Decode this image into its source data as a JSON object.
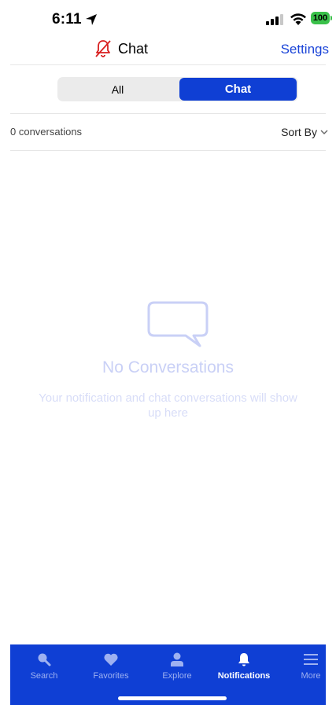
{
  "status_bar": {
    "time": "6:11",
    "battery": "100"
  },
  "header": {
    "title": "Chat",
    "settings_label": "Settings"
  },
  "segments": {
    "all_label": "All",
    "chat_label": "Chat",
    "selected": "Chat"
  },
  "list": {
    "count_label": "0 conversations",
    "sort_label": "Sort By"
  },
  "empty_state": {
    "title": "No Conversations",
    "subtitle": "Your notification and chat conversations will show up here"
  },
  "tab_bar": {
    "items": [
      {
        "label": "Search",
        "icon": "search-icon"
      },
      {
        "label": "Favorites",
        "icon": "heart-icon"
      },
      {
        "label": "Explore",
        "icon": "person-icon"
      },
      {
        "label": "Notifications",
        "icon": "bell-icon",
        "active": true
      },
      {
        "label": "More",
        "icon": "menu-icon"
      }
    ]
  },
  "colors": {
    "accent": "#0f3fd4",
    "link": "#1a44d8",
    "mute_icon": "#d81e1e",
    "battery": "#3ac14a"
  }
}
